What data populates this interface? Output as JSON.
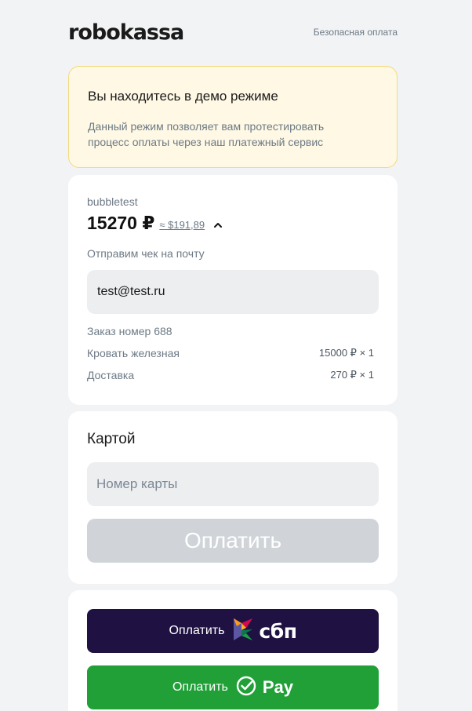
{
  "header": {
    "logo": "robokassa",
    "secure_label": "Безопасная оплата"
  },
  "demo": {
    "title": "Вы находитесь в демо режиме",
    "text": "Данный режим позволяет вам протестировать процесс оплаты через наш платежный сервис"
  },
  "order": {
    "shop": "bubbletest",
    "amount": "15270 ₽",
    "usd_amount": "≈ $191,89",
    "receipt_label": "Отправим чек на почту",
    "email": "test@test.ru",
    "order_number": "Заказ номер 688",
    "items": [
      {
        "name": "Кровать железная",
        "qty": "15000 ₽ × 1"
      },
      {
        "name": "Доставка",
        "qty": "270 ₽ × 1"
      }
    ]
  },
  "card_payment": {
    "title": "Картой",
    "card_placeholder": "Номер карты",
    "pay_label": "Оплатить"
  },
  "alt_payment": {
    "sbp_label": "Оплатить",
    "sbp_brand": "сбп",
    "sber_label": "Оплатить",
    "sber_brand": "Pay"
  },
  "colors": {
    "sbp_bg": "#1f1242",
    "sber_bg": "#21a038",
    "demo_bg": "#fef8e4",
    "page_bg": "#f2f3f5"
  }
}
